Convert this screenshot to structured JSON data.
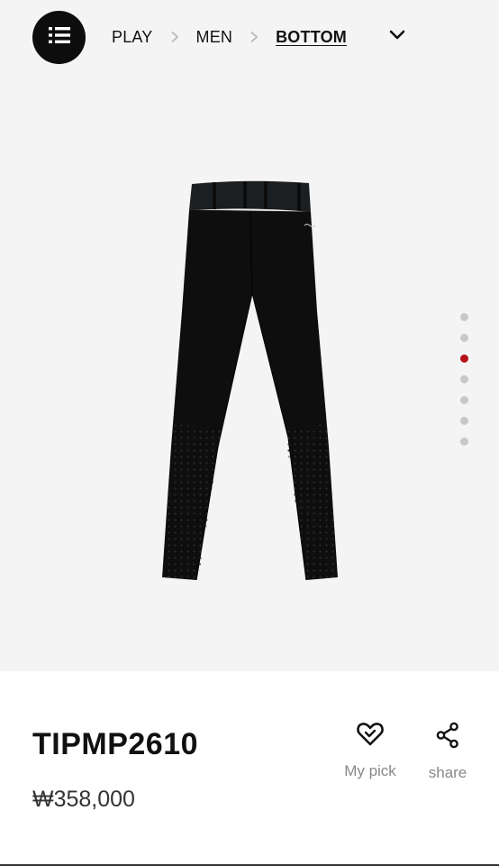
{
  "nav": {
    "menu_icon": "list-icon",
    "breadcrumb": [
      "PLAY",
      "MEN",
      "BOTTOM"
    ],
    "dropdown_icon": "chevron-down-icon"
  },
  "gallery": {
    "slide_count": 7,
    "active_slide": 3,
    "accent_color": "#b5121b"
  },
  "product": {
    "name": "TIPMP2610",
    "price": "₩358,000"
  },
  "actions": {
    "pick_label": "My pick",
    "pick_icon": "heart-icon",
    "share_label": "share",
    "share_icon": "share-icon"
  }
}
